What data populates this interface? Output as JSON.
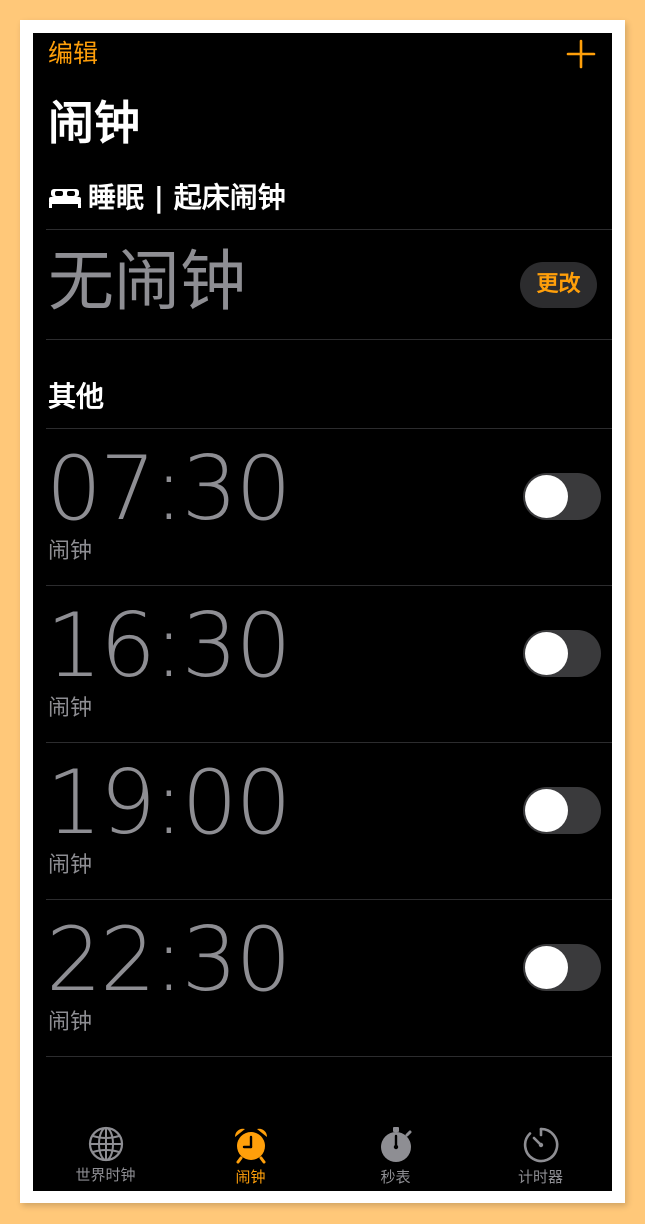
{
  "header": {
    "edit_label": "编辑",
    "title": "闹钟"
  },
  "sleep": {
    "section_title": "睡眠 | 起床闹钟",
    "status": "无闹钟",
    "change_label": "更改"
  },
  "other": {
    "section_title": "其他"
  },
  "alarms": [
    {
      "time": "07:30",
      "label": "闹钟",
      "enabled": false
    },
    {
      "time": "16:30",
      "label": "闹钟",
      "enabled": false
    },
    {
      "time": "19:00",
      "label": "闹钟",
      "enabled": false
    },
    {
      "time": "22:30",
      "label": "闹钟",
      "enabled": false
    }
  ],
  "tabs": [
    {
      "label": "世界时钟",
      "icon": "globe-icon",
      "active": false
    },
    {
      "label": "闹钟",
      "icon": "alarm-clock-icon",
      "active": true
    },
    {
      "label": "秒表",
      "icon": "stopwatch-icon",
      "active": false
    },
    {
      "label": "计时器",
      "icon": "timer-icon",
      "active": false
    }
  ],
  "colors": {
    "accent": "#ff9f0a",
    "inactive": "#8e8e93",
    "background": "#000000"
  }
}
